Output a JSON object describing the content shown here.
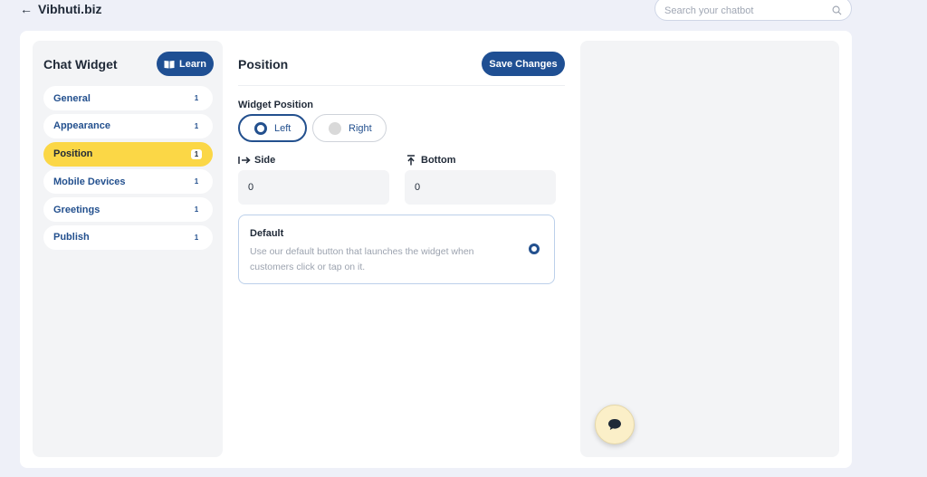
{
  "header": {
    "title": "Vibhuti.biz",
    "back_icon": "arrow-left-icon"
  },
  "search": {
    "placeholder": "Search your chatbot",
    "icon": "search-icon"
  },
  "sidebar": {
    "title": "Chat Widget",
    "learn_label": "Learn",
    "learn_icon": "book-icon",
    "items": [
      {
        "label": "General",
        "badge": "1",
        "active": false
      },
      {
        "label": "Appearance",
        "badge": "1",
        "active": false
      },
      {
        "label": "Position",
        "badge": "1",
        "active": true
      },
      {
        "label": "Mobile Devices",
        "badge": "1",
        "active": false
      },
      {
        "label": "Greetings",
        "badge": "1",
        "active": false
      },
      {
        "label": "Publish",
        "badge": "1",
        "active": false
      }
    ]
  },
  "main": {
    "title": "Position",
    "save_label": "Save Changes",
    "widget_position": {
      "label": "Widget Position",
      "options": [
        {
          "label": "Left",
          "selected": true
        },
        {
          "label": "Right",
          "selected": false
        }
      ]
    },
    "side": {
      "label": "Side",
      "value": "0",
      "icon": "arrow-right-to-line-icon"
    },
    "bottom": {
      "label": "Bottom",
      "value": "0",
      "icon": "arrow-up-to-line-icon"
    },
    "default_option": {
      "title": "Default",
      "description": "Use our default button that launches the widget when customers click or tap on it.",
      "selected": true
    }
  },
  "preview": {
    "launcher_icon": "chat-bubble-icon"
  },
  "colors": {
    "primary": "#1f4f93",
    "active_nav": "#fbd746",
    "launcher_bg": "#fbefc8",
    "page_bg": "#eef0f8"
  }
}
